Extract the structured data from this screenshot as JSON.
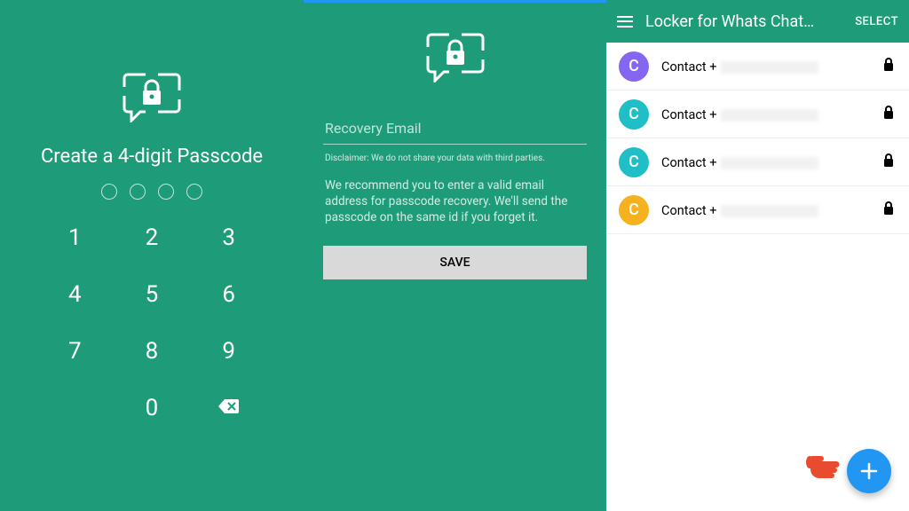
{
  "screen1": {
    "title": "Create a 4-digit Passcode",
    "keys": [
      "1",
      "2",
      "3",
      "4",
      "5",
      "6",
      "7",
      "8",
      "9",
      "0"
    ]
  },
  "screen2": {
    "input_placeholder": "Recovery Email",
    "disclaimer": "Disclaimer: We do not share your data with third parties.",
    "recommend": "We recommend you to enter a valid email address for passcode recovery. We'll send the passcode on the same id if you forget it.",
    "save_label": "SAVE"
  },
  "screen3": {
    "title": "Locker for Whats Chat…",
    "select_label": "SELECT",
    "contacts": [
      {
        "avatar_letter": "C",
        "label_prefix": "Contact +",
        "color": "av-purple"
      },
      {
        "avatar_letter": "C",
        "label_prefix": "Contact +",
        "color": "av-teal"
      },
      {
        "avatar_letter": "C",
        "label_prefix": "Contact +",
        "color": "av-teal2"
      },
      {
        "avatar_letter": "C",
        "label_prefix": "Contact +",
        "color": "av-orange"
      }
    ],
    "fab_label": "+"
  }
}
